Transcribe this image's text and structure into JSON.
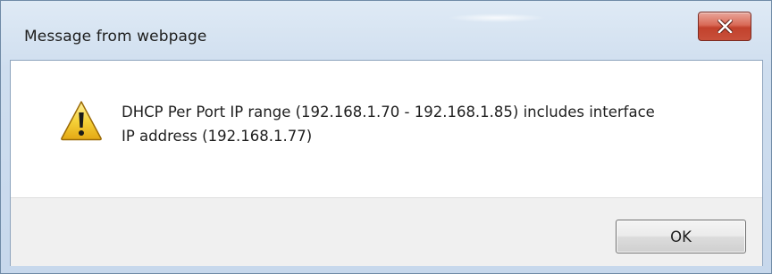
{
  "window": {
    "title": "Message from webpage"
  },
  "dialog": {
    "icon": "warning-icon",
    "message_line1": "DHCP Per Port IP range (192.168.1.70 - 192.168.1.85) includes interface",
    "message_line2": "IP address (192.168.1.77)"
  },
  "buttons": {
    "ok_label": "OK",
    "close_icon": "close-icon"
  },
  "colors": {
    "close_button": "#c8503a",
    "warning_fill": "#f6d23a",
    "titlebar": "#cfdeef"
  }
}
